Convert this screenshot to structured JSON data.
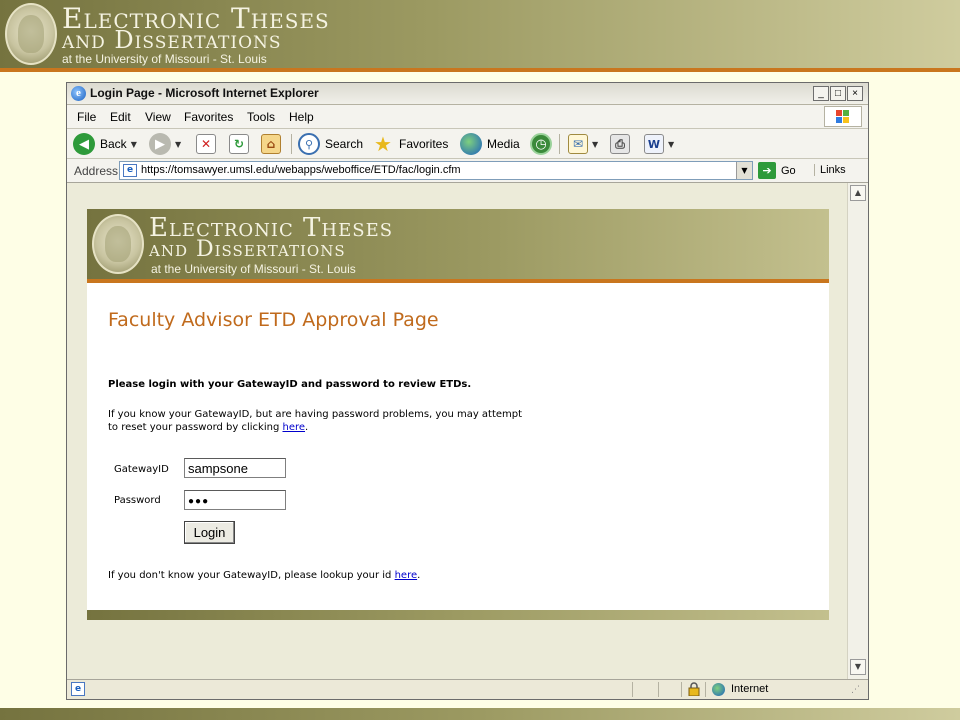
{
  "slide": {
    "banner_line1": "Electronic Theses",
    "banner_line2": "and Dissertations",
    "banner_subtitle": "at the University of Missouri - St. Louis",
    "colors": {
      "banner_dark": "#75733f",
      "banner_light": "#cfcc9e",
      "accent_line": "#c9761e",
      "background": "#fefee6"
    }
  },
  "browser": {
    "title": "Login Page - Microsoft Internet Explorer",
    "window_buttons": {
      "minimize": "_",
      "maximize": "□",
      "close": "×"
    },
    "menu": [
      "File",
      "Edit",
      "View",
      "Favorites",
      "Tools",
      "Help"
    ],
    "toolbar": {
      "back": "Back",
      "search": "Search",
      "favorites": "Favorites",
      "media": "Media"
    },
    "address": {
      "label": "Address",
      "url": "https://tomsawyer.umsl.edu/webapps/weboffice/ETD/fac/login.cfm",
      "go": "Go",
      "links": "Links"
    },
    "status": {
      "zone": "Internet"
    }
  },
  "page": {
    "banner_line1": "Electronic Theses",
    "banner_line2": "and Dissertations",
    "banner_subtitle": "at the University of Missouri - St. Louis",
    "heading": "Faculty Advisor ETD Approval Page",
    "instruction": "Please login with your GatewayID and password to review ETDs.",
    "reset_text": "If you know your GatewayID, but are having password problems, you may attempt to reset your password by clicking",
    "reset_link": "here",
    "reset_end": ".",
    "gateway_label": "GatewayID",
    "gateway_value": "sampsone",
    "password_label": "Password",
    "password_value": "●●●",
    "login_button": "Login",
    "lookup_text": "If you don't know your GatewayID, please lookup your id",
    "lookup_link": "here",
    "lookup_end": ".",
    "colors": {
      "heading": "#c06a1c",
      "link": "#0000cc"
    }
  }
}
